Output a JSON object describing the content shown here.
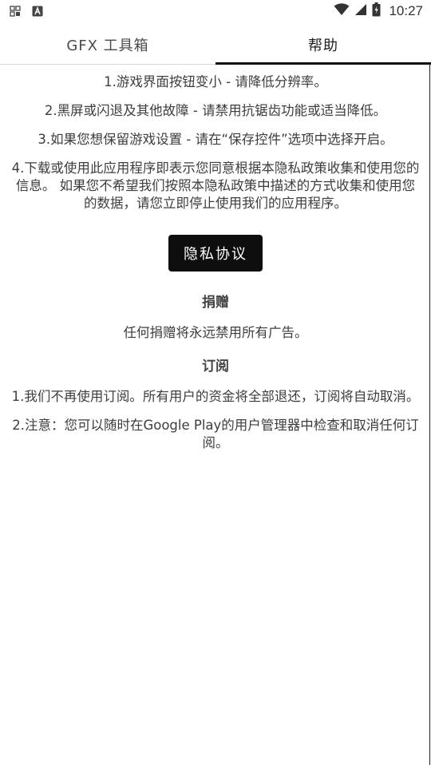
{
  "status_bar": {
    "time": "10:27",
    "left_icons": [
      "notification-grid-icon",
      "a-app-icon"
    ],
    "right_icons": [
      "wifi-icon",
      "signal-icon",
      "battery-icon"
    ]
  },
  "tabs": [
    {
      "label": "GFX 工具箱",
      "active": false
    },
    {
      "label": "帮助",
      "active": true
    }
  ],
  "help": {
    "paragraphs": [
      "1.游戏界面按钮变小 - 请降低分辨率。",
      "2.黑屏或闪退及其他故障 - 请禁用抗锯齿功能或适当降低。",
      "3.如果您想保留游戏设置 - 请在“保存控件”选项中选择开启。",
      "4.下载或使用此应用程序即表示您同意根据本隐私政策收集和使用您的信息。 如果您不希望我们按照本隐私政策中描述的方式收集和使用您的数据，请您立即停止使用我们的应用程序。"
    ],
    "privacy_button": "隐私协议"
  },
  "donation": {
    "title": "捐赠",
    "text": "任何捐赠将永远禁用所有广告。"
  },
  "subscription": {
    "title": "订阅",
    "paragraphs": [
      "1.我们不再使用订阅。所有用户的资金将全部退还，订阅将自动取消。",
      "2.注意：您可以随时在Google Play的用户管理器中检查和取消任何订阅。"
    ]
  },
  "colors": {
    "button_bg": "#0e0e0e",
    "text": "#3d3d3d",
    "active_tab_indicator": "#111111"
  }
}
